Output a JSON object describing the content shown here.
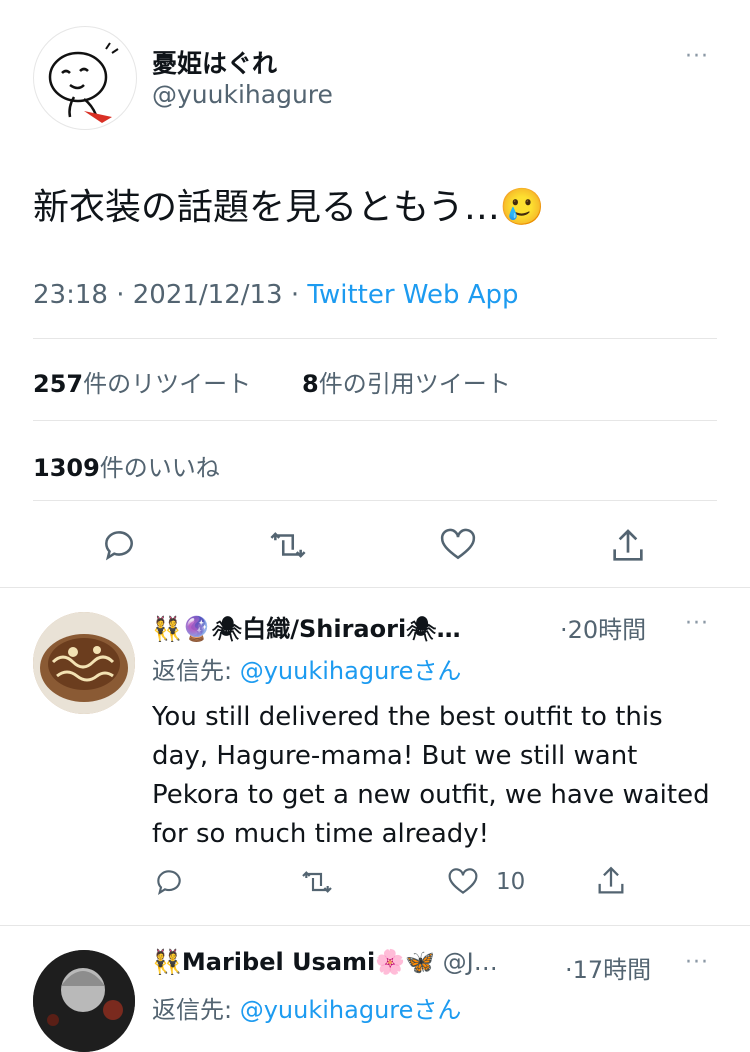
{
  "main_tweet": {
    "author_name": "憂姫はぐれ",
    "author_handle": "@yuukihagure",
    "text": "新衣装の話題を見るともう…🥲",
    "time": "23:18",
    "separator": "·",
    "date": "2021/12/13",
    "source": "Twitter Web App",
    "retweet_count": "257",
    "retweet_label": "件のリツイート",
    "quote_count": "8",
    "quote_label": "件の引用ツイート",
    "like_count": "1309",
    "like_label": "件のいいね"
  },
  "replies": [
    {
      "author_name": "👯🔮🕷白織/Shiraori🕷…",
      "time_ago": "·20時間",
      "reply_to_prefix": "返信先: ",
      "reply_to_handle": "@yuukihagure",
      "reply_to_suffix": "さん",
      "text": "You still delivered the best outfit to this day, Hagure-mama! But we still want Pekora to get a new outfit, we have waited for so much time already!",
      "like_count": "10"
    },
    {
      "author_name": "👯Maribel Usami🌸🦋",
      "author_handle": "@J…",
      "time_ago": "·17時間",
      "reply_to_prefix": "返信先: ",
      "reply_to_handle": "@yuukihagure",
      "reply_to_suffix": "さん"
    }
  ],
  "more_icon": "···",
  "icons": [
    "reply-icon",
    "retweet-icon",
    "like-icon",
    "share-icon",
    "more-icon"
  ],
  "colors": {
    "link": "#1d9bf0",
    "muted": "#536471",
    "divider": "#e6e6e6"
  }
}
